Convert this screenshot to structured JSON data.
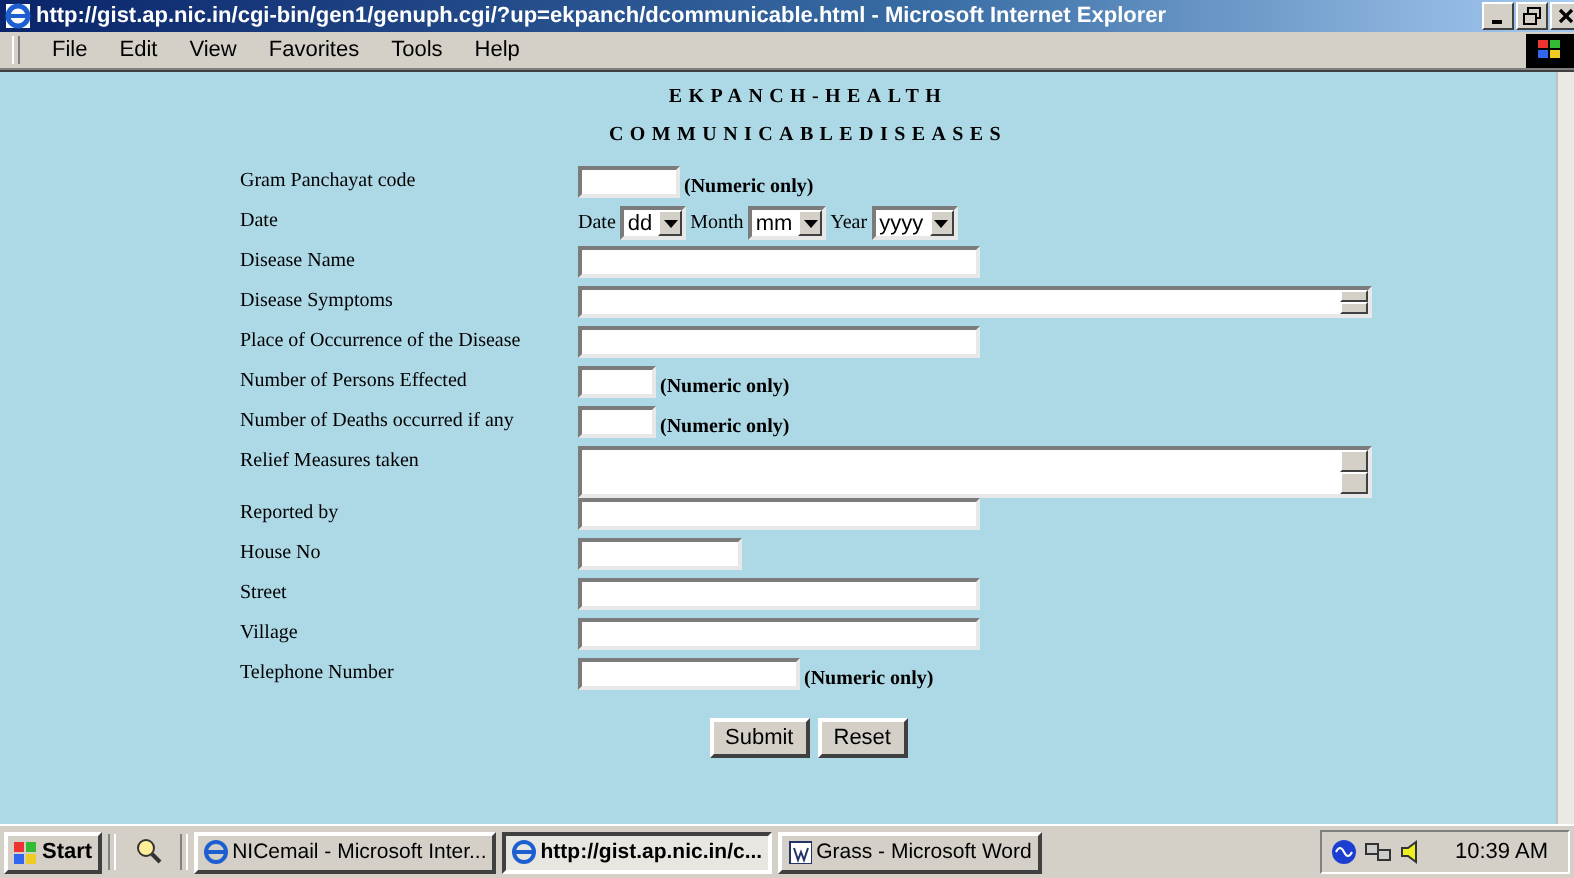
{
  "window": {
    "title": "http://gist.ap.nic.in/cgi-bin/gen1/genuph.cgi/?up=ekpanch/dcommunicable.html - Microsoft Internet Explorer"
  },
  "menu": [
    "File",
    "Edit",
    "View",
    "Favorites",
    "Tools",
    "Help"
  ],
  "headings": [
    "EKPANCH-HEALTH",
    "COMMUNICABLEDISEASES"
  ],
  "fields": [
    {
      "kind": "short",
      "label": "Gram Panchayat code",
      "note": "(Numeric only)"
    },
    {
      "kind": "date",
      "label": "Date",
      "parts": [
        {
          "label": "Date",
          "value": "dd"
        },
        {
          "label": "Month",
          "value": "mm"
        },
        {
          "label": "Year",
          "value": "yyyy"
        }
      ]
    },
    {
      "kind": "long",
      "label": "Disease Name"
    },
    {
      "kind": "memo-one",
      "label": "Disease Symptoms"
    },
    {
      "kind": "long",
      "label": "Place of Occurrence of the Disease"
    },
    {
      "kind": "tiny",
      "label": "Number of Persons Effected",
      "note": "(Numeric only)"
    },
    {
      "kind": "tiny",
      "label": "Number of Deaths occurred if any",
      "note": "(Numeric only)"
    },
    {
      "kind": "memo",
      "label": "Relief Measures taken"
    },
    {
      "kind": "long",
      "label": "Reported by"
    },
    {
      "kind": "medium",
      "label": "House No"
    },
    {
      "kind": "long",
      "label": "Street"
    },
    {
      "kind": "long",
      "label": "Village"
    },
    {
      "kind": "medium-wide",
      "label": "Telephone Number",
      "note": "(Numeric only)"
    }
  ],
  "buttons": [
    "Submit",
    "Reset"
  ],
  "taskbar": {
    "start": "Start",
    "tasks": [
      {
        "label": "NICemail - Microsoft Inter...",
        "selected": false
      },
      {
        "label": "http://gist.ap.nic.in/c...",
        "selected": true
      },
      {
        "label": "Grass - Microsoft Word",
        "selected": false
      }
    ],
    "clock": "10:39 AM"
  }
}
